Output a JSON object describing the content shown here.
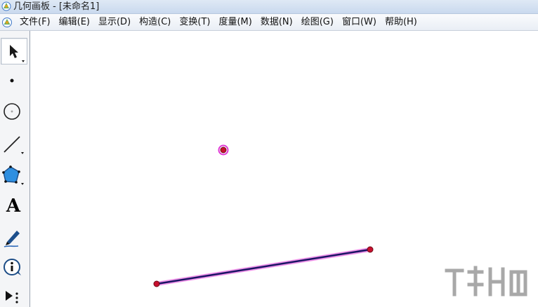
{
  "window": {
    "title": "几何画板 - [未命名1]"
  },
  "menubar": {
    "items": [
      {
        "label": "文件(F)"
      },
      {
        "label": "编辑(E)"
      },
      {
        "label": "显示(D)"
      },
      {
        "label": "构造(C)"
      },
      {
        "label": "变换(T)"
      },
      {
        "label": "度量(M)"
      },
      {
        "label": "数据(N)"
      },
      {
        "label": "绘图(G)"
      },
      {
        "label": "窗口(W)"
      },
      {
        "label": "帮助(H)"
      }
    ]
  },
  "toolbox": {
    "tools": [
      {
        "name": "arrow-tool-icon",
        "selected": true
      },
      {
        "name": "point-tool-icon"
      },
      {
        "name": "compass-tool-icon"
      },
      {
        "name": "straightedge-tool-icon"
      },
      {
        "name": "polygon-tool-icon"
      },
      {
        "name": "text-tool-icon",
        "glyph": "A"
      },
      {
        "name": "marker-tool-icon"
      },
      {
        "name": "information-tool-icon"
      },
      {
        "name": "custom-tool-icon"
      }
    ]
  },
  "canvas": {
    "colors": {
      "point_fill": "#c8102e",
      "point_outline": "#6d0b17",
      "selection_highlight": "#e03ad6",
      "segment": "#1a1464"
    }
  }
}
